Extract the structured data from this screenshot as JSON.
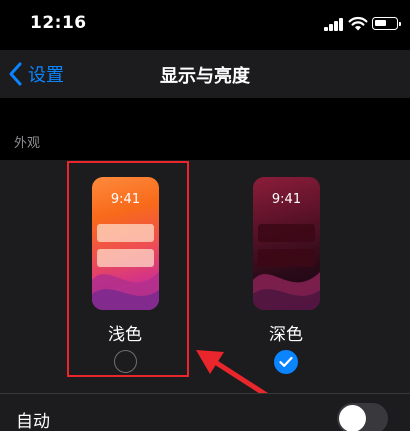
{
  "status_bar": {
    "time": "12:16"
  },
  "nav": {
    "back_label": "设置",
    "title": "显示与亮度"
  },
  "appearance": {
    "section_label": "外观",
    "options": [
      {
        "preview_time": "9:41",
        "label": "浅色",
        "selected": false
      },
      {
        "preview_time": "9:41",
        "label": "深色",
        "selected": true
      }
    ]
  },
  "auto": {
    "label": "自动",
    "enabled": false
  },
  "colors": {
    "accent": "#0a84ff",
    "highlight": "#e8262b",
    "background": "#000000",
    "cell": "#1c1c1e"
  },
  "icons": [
    "cellular-signal-icon",
    "wifi-icon",
    "battery-icon",
    "chevron-left-icon",
    "checkmark-icon"
  ]
}
